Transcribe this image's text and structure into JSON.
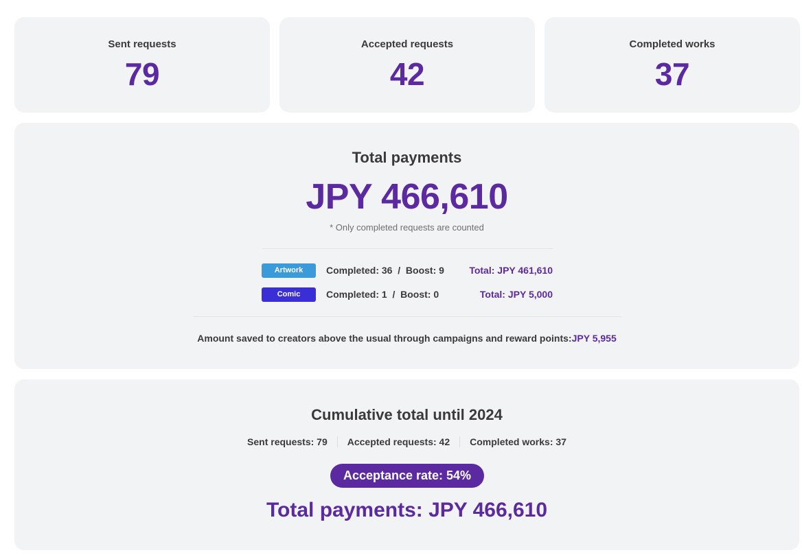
{
  "stats": {
    "sent": {
      "label": "Sent requests",
      "value": "79"
    },
    "accepted": {
      "label": "Accepted requests",
      "value": "42"
    },
    "completed": {
      "label": "Completed works",
      "value": "37"
    }
  },
  "payments": {
    "title": "Total payments",
    "amount": "JPY 466,610",
    "note": "* Only completed requests are counted",
    "rows": [
      {
        "badge": "Artwork",
        "badge_color": "#3b9ad9",
        "stats": "Completed: 36  /  Boost: 9",
        "total": "Total: JPY 461,610"
      },
      {
        "badge": "Comic",
        "badge_color": "#3a2fd6",
        "stats": "Completed: 1  /  Boost: 0",
        "total": "Total: JPY 5,000"
      }
    ],
    "saved_label": "Amount saved to creators above the usual through campaigns and reward points:",
    "saved_value": "JPY 5,955"
  },
  "cumulative": {
    "title": "Cumulative total until 2024",
    "sent": "Sent requests: 79",
    "accepted": "Accepted requests: 42",
    "completed": "Completed works: 37",
    "acceptance_rate": "Acceptance rate: 54%",
    "total": "Total payments: JPY 466,610"
  },
  "colors": {
    "accent": "#5b2aa0",
    "card_bg": "#f2f3f5",
    "text": "#3a3a3a"
  }
}
